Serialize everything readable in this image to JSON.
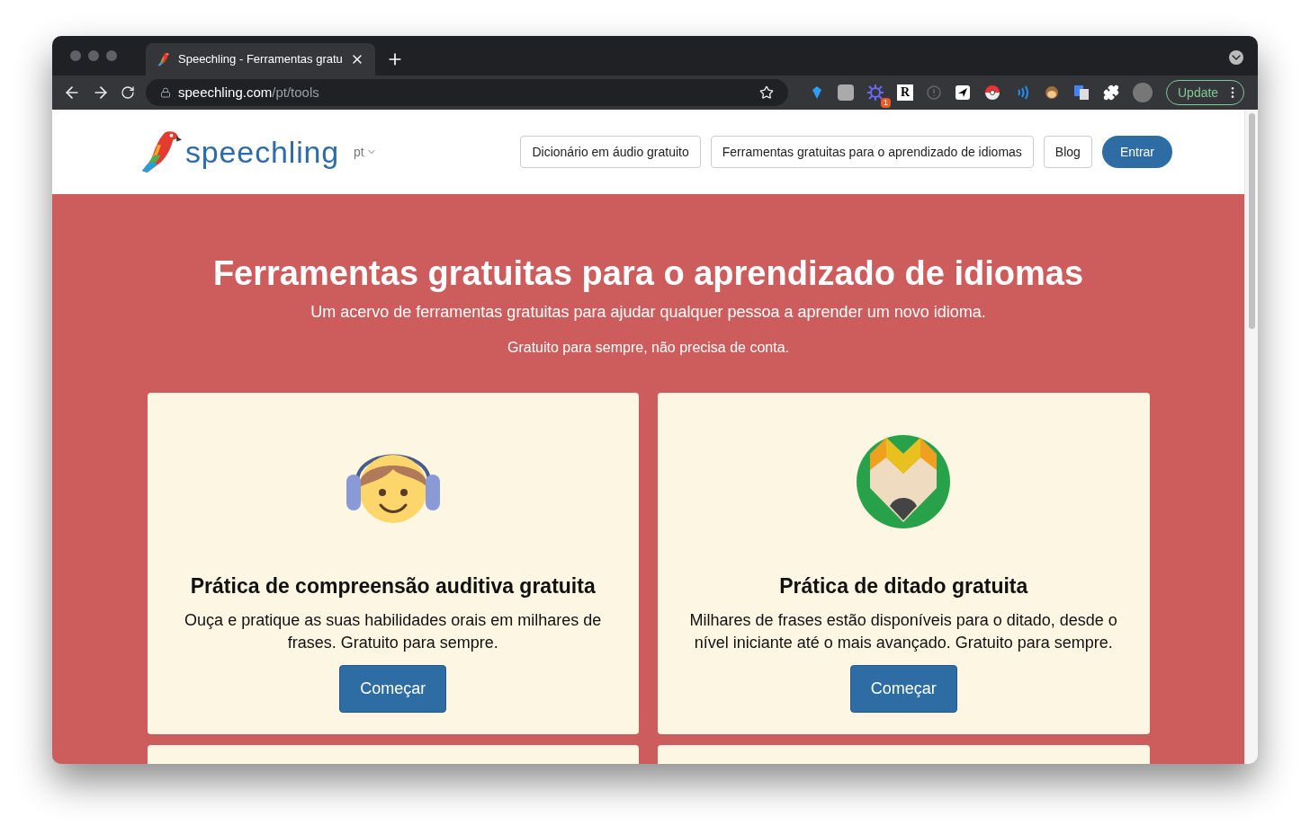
{
  "browser": {
    "tab": {
      "title": "Speechling - Ferramentas gratu",
      "selected": true
    },
    "url": {
      "domain": "speechling.com",
      "path": "/pt/tools"
    },
    "extensions": {
      "badge": "1",
      "letter": "R"
    },
    "update_button": "Update"
  },
  "site": {
    "logo": "speechling",
    "language": "pt",
    "nav": [
      {
        "label": "Dicionário em áudio gratuito",
        "kind": "outline"
      },
      {
        "label": "Ferramentas gratuitas para o aprendizado de idiomas",
        "kind": "outline"
      },
      {
        "label": "Blog",
        "kind": "outline"
      },
      {
        "label": "Entrar",
        "kind": "primary"
      }
    ]
  },
  "hero": {
    "title": "Ferramentas gratuitas para o aprendizado de idiomas",
    "subtitle": "Um acervo de ferramentas gratuitas para ajudar qualquer pessoa a aprender um novo idioma.",
    "note": "Gratuito para sempre, não precisa de conta."
  },
  "cards": [
    {
      "kind": "listening",
      "title": "Prática de compreensão auditiva gratuita",
      "text": "Ouça e pratique as suas habilidades orais em milhares de frases. Gratuito para sempre.",
      "button": "Começar"
    },
    {
      "kind": "dictation",
      "title": "Prática de ditado gratuita",
      "text": "Milhares de frases estão disponíveis para o ditado, desde o nível iniciante até o mais avançado. Gratuito para sempre.",
      "button": "Começar"
    }
  ]
}
